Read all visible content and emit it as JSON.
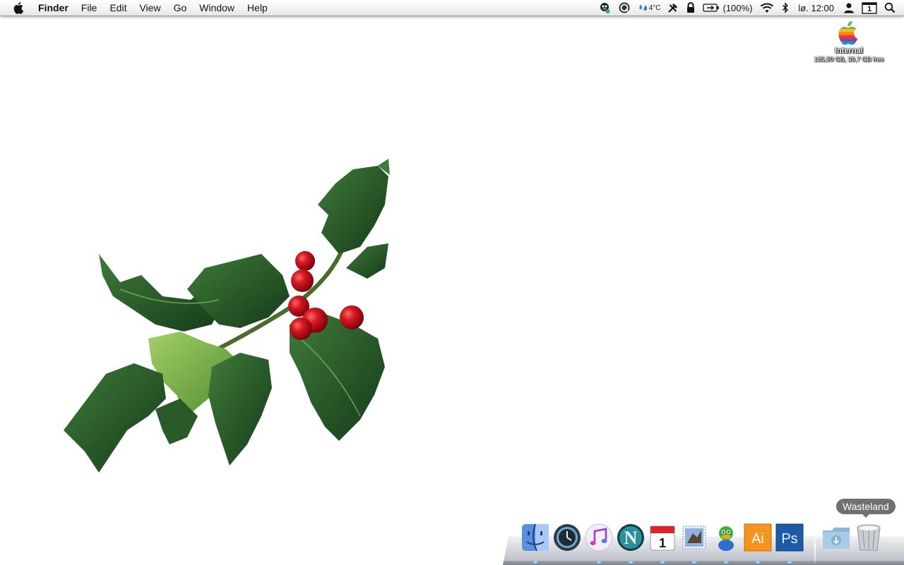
{
  "menubar": {
    "app_name": "Finder",
    "menus": [
      "File",
      "Edit",
      "View",
      "Go",
      "Window",
      "Help"
    ],
    "status": {
      "temperature": "4°C",
      "battery": "(100%)",
      "clock": "lø. 12:00",
      "calendar_day": "1"
    }
  },
  "desktop": {
    "disk": {
      "name": "Internal",
      "info": "185,99 GB, 39,7 GB free"
    }
  },
  "dock": {
    "items": [
      {
        "name": "finder-dock-icon"
      },
      {
        "name": "time-machine-dock-icon"
      },
      {
        "name": "itunes-dock-icon"
      },
      {
        "name": "netscape-dock-icon"
      },
      {
        "name": "calendar-dock-icon",
        "label": "1"
      },
      {
        "name": "mail-dock-icon"
      },
      {
        "name": "adium-dock-icon"
      },
      {
        "name": "illustrator-dock-icon",
        "label": "Ai"
      },
      {
        "name": "photoshop-dock-icon",
        "label": "Ps"
      },
      {
        "name": "downloads-folder-dock-icon"
      },
      {
        "name": "trash-dock-icon"
      }
    ],
    "tooltip": "Wasteland"
  },
  "colors": {
    "illustrator": "#f7941d",
    "photoshop": "#1d5aa8",
    "holly_dark": "#1f4a22",
    "holly_light": "#6fa33c",
    "berry": "#c8101c"
  }
}
